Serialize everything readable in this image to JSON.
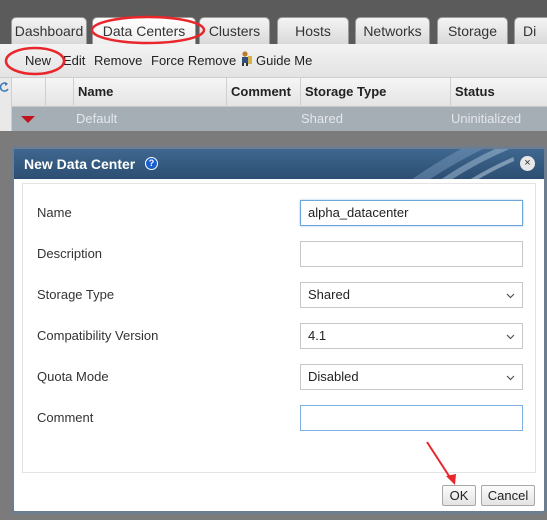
{
  "tabs": [
    {
      "label": "Dashboard",
      "active": false
    },
    {
      "label": "Data Centers",
      "active": true
    },
    {
      "label": "Clusters",
      "active": false
    },
    {
      "label": "Hosts",
      "active": false
    },
    {
      "label": "Networks",
      "active": false
    },
    {
      "label": "Storage",
      "active": false
    },
    {
      "label": "Di",
      "active": false
    }
  ],
  "toolbar": {
    "new_label": "New",
    "edit_label": "Edit",
    "remove_label": "Remove",
    "force_remove_label": "Force Remove",
    "guide_me_label": "Guide Me"
  },
  "grid": {
    "columns": [
      "Name",
      "Comment",
      "Storage Type",
      "Status"
    ],
    "rows": [
      {
        "name": "Default",
        "comment": "",
        "storage_type": "Shared",
        "status": "Uninitialized"
      }
    ]
  },
  "dialog": {
    "title": "New Data Center",
    "help_glyph": "?",
    "close_glyph": "×",
    "fields": {
      "name": {
        "label": "Name",
        "value": "alpha_datacenter"
      },
      "description": {
        "label": "Description",
        "value": ""
      },
      "storage_type": {
        "label": "Storage Type",
        "value": "Shared"
      },
      "compatibility_version": {
        "label": "Compatibility Version",
        "value": "4.1"
      },
      "quota_mode": {
        "label": "Quota Mode",
        "value": "Disabled"
      },
      "comment": {
        "label": "Comment",
        "value": ""
      }
    },
    "ok_label": "OK",
    "cancel_label": "Cancel"
  },
  "colors": {
    "header_blue": "#2c4e72",
    "annotation_red": "#e8262b",
    "overlay_gray": "#7b7b7b",
    "selected_row": "#a5adb5"
  },
  "icons": [
    "guide-me-icon",
    "refresh-icon",
    "row-expand-arrow-icon",
    "help-icon",
    "close-icon",
    "chevron-down-icon"
  ]
}
